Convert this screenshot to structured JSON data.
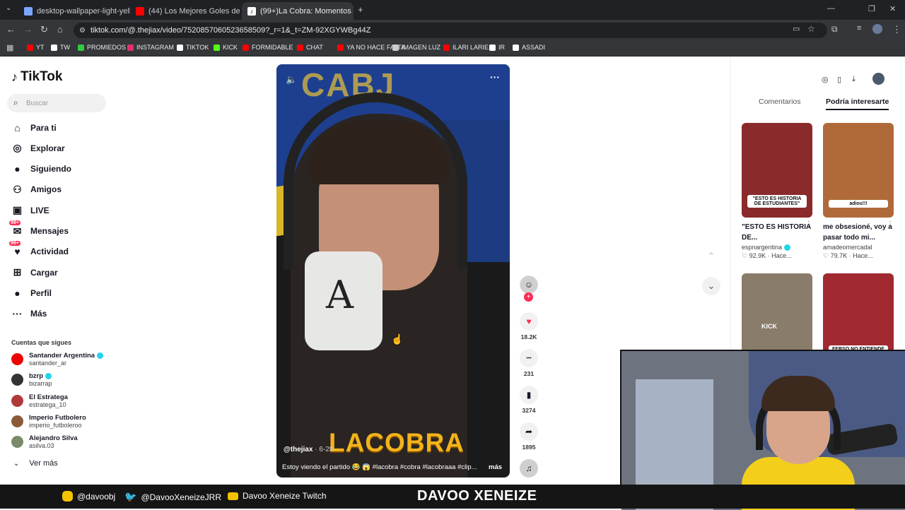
{
  "browser": {
    "tabs": [
      {
        "title": "desktop-wallpaper-light-yellow",
        "color": "#7aa7ff"
      },
      {
        "title": "(44) Los Mejores Goles de Tiro",
        "color": "#ff0000"
      },
      {
        "title": "(99+)La Cobra: Momentos",
        "color": "#111111"
      }
    ],
    "url": "tiktok.com/@.thejiax/video/7520857060523658509?_r=1&_t=ZM-92XGYWBg44Z",
    "bookmarks": [
      {
        "label": "YT",
        "color": "#ff0000"
      },
      {
        "label": "TW",
        "color": "#ffffff"
      },
      {
        "label": "PROMIEDOS",
        "color": "#2ecc40"
      },
      {
        "label": "INSTAGRAM",
        "color": "#e1306c"
      },
      {
        "label": "TIKTOK",
        "color": "#ffffff"
      },
      {
        "label": "KICK",
        "color": "#53fc18"
      },
      {
        "label": "FORMIDABLE",
        "color": "#ff0000"
      },
      {
        "label": "CHAT",
        "color": "#ff0000"
      },
      {
        "label": "YA NO HACE FALTA",
        "color": "#ff0000"
      },
      {
        "label": "IMAGEN LUZ",
        "color": "#cccccc"
      },
      {
        "label": "ILARI LARIE",
        "color": "#ff0000"
      },
      {
        "label": "IR",
        "color": "#ffffff"
      },
      {
        "label": "ASSADI",
        "color": "#ffffff"
      }
    ]
  },
  "tiktok": {
    "logo": "TikTok",
    "search_placeholder": "Buscar",
    "nav": [
      {
        "label": "Para ti",
        "icon": "home-icon"
      },
      {
        "label": "Explorar",
        "icon": "compass-icon"
      },
      {
        "label": "Siguiendo",
        "icon": "following-avatar-icon"
      },
      {
        "label": "Amigos",
        "icon": "friends-icon"
      },
      {
        "label": "LIVE",
        "icon": "live-icon"
      },
      {
        "label": "Mensajes",
        "icon": "messages-icon",
        "badge": "99+"
      },
      {
        "label": "Actividad",
        "icon": "activity-icon",
        "badge": "99+"
      },
      {
        "label": "Cargar",
        "icon": "upload-icon"
      },
      {
        "label": "Perfil",
        "icon": "profile-icon"
      },
      {
        "label": "Más",
        "icon": "more-icon"
      }
    ],
    "following_header": "Cuentas que sigues",
    "following": [
      {
        "name": "Santander Argentina",
        "handle": "santander_ar",
        "verified": true,
        "color": "#ec0000"
      },
      {
        "name": "bzrp",
        "handle": "bizarrap",
        "verified": true,
        "color": "#333333"
      },
      {
        "name": "El Estratega",
        "handle": "estratega_10",
        "verified": false,
        "color": "#b03a3a"
      },
      {
        "name": "Imperio Futbolero",
        "handle": "imperio_futboleroo",
        "verified": false,
        "color": "#8a5a3a"
      },
      {
        "name": "Alejandro Silva",
        "handle": "asilva.03",
        "verified": false,
        "color": "#7a8a6a"
      }
    ],
    "see_more": "Ver más",
    "video": {
      "author": "@thejiax",
      "date": "· 6-28",
      "caption": "Estoy viendo el partido 😂 😱 #lacobra #cobra #lacobraaa #clip...",
      "more": "más",
      "overlay_text": "LACOBRA",
      "bg_text": "CABJ"
    },
    "actions": [
      {
        "name": "like",
        "icon": "heart-icon",
        "count": "18.2K",
        "color": "#fe2c55"
      },
      {
        "name": "comment",
        "icon": "comment-icon",
        "count": "231"
      },
      {
        "name": "save",
        "icon": "bookmark-icon",
        "count": "3274"
      },
      {
        "name": "share",
        "icon": "share-icon",
        "count": "1895"
      }
    ],
    "right_tabs": [
      "Comentarios",
      "Podría interesarte"
    ],
    "suggested": [
      {
        "title": "\"ESTO ES HISTORIA DE...",
        "user": "espnargentina",
        "verified": true,
        "stats": "♡ 92.9K · Hace...",
        "thumb_text": "\"ESTO ES HISTORIA DE ESTUDIANTES\"",
        "bg": "#8a2a2a"
      },
      {
        "title": "me obsesioné, voy a pasar todo mi...",
        "user": "amadeomercadal",
        "verified": false,
        "stats": "♡ 79.7K · Hace...",
        "thumb_text": "adios!!!",
        "bg": "#b06a3a"
      },
      {
        "title": "",
        "user": "",
        "verified": false,
        "stats": "",
        "thumb_text": "KICK",
        "bg": "#8a7c6a"
      },
      {
        "title": "",
        "user": "",
        "verified": false,
        "stats": "",
        "thumb_text": "FERSO NO ENTIENDE A LAS MUJERES",
        "bg": "#a02a30"
      }
    ]
  },
  "stream_overlay": {
    "instagram": "@davoobj",
    "twitter": "@DavooXeneizeJRR",
    "twitch": "Davoo Xeneize Twitch",
    "brand": "DAVOO XENEIZE"
  }
}
